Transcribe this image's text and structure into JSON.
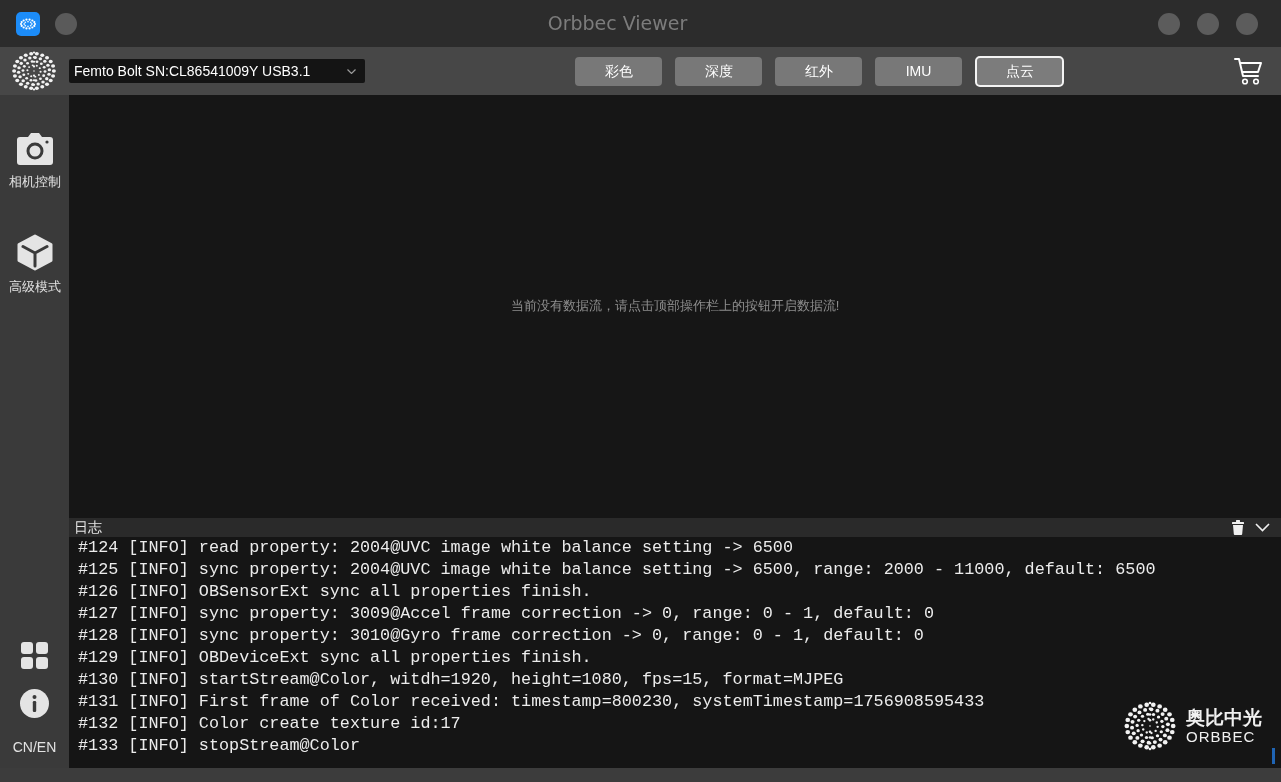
{
  "window": {
    "title": "Orbbec Viewer"
  },
  "toolbar": {
    "device_select": {
      "value": "Femto Bolt SN:CL86541009Y USB3.1"
    },
    "stream_buttons": [
      {
        "label": "彩色",
        "selected": false
      },
      {
        "label": "深度",
        "selected": false
      },
      {
        "label": "红外",
        "selected": false
      },
      {
        "label": "IMU",
        "selected": false
      },
      {
        "label": "点云",
        "selected": true
      }
    ]
  },
  "sidebar": {
    "items": [
      {
        "label": "相机控制"
      },
      {
        "label": "高级模式"
      }
    ],
    "language": "CN/EN"
  },
  "viewport": {
    "message": "当前没有数据流，请点击顶部操作栏上的按钮开启数据流!"
  },
  "log": {
    "title": "日志",
    "lines": [
      "#124 [INFO] read property: 2004@UVC image white balance setting -> 6500",
      "#125 [INFO] sync property: 2004@UVC image white balance setting -> 6500, range: 2000 - 11000, default: 6500",
      "#126 [INFO] OBSensorExt sync all properties finish.",
      "#127 [INFO] sync property: 3009@Accel frame correction -> 0, range: 0 - 1, default: 0",
      "#128 [INFO] sync property: 3010@Gyro frame correction -> 0, range: 0 - 1, default: 0",
      "#129 [INFO] OBDeviceExt sync all properties finish.",
      "#130 [INFO] startStream@Color, witdh=1920, height=1080, fps=15, format=MJPEG",
      "#131 [INFO] First frame of Color received: timestamp=800230, systemTimestamp=1756908595433",
      "#132 [INFO] Color create texture id:17",
      "#133 [INFO] stopStream@Color"
    ],
    "logo": {
      "name_cn": "奥比中光",
      "name_en": "ORBBEC"
    }
  }
}
